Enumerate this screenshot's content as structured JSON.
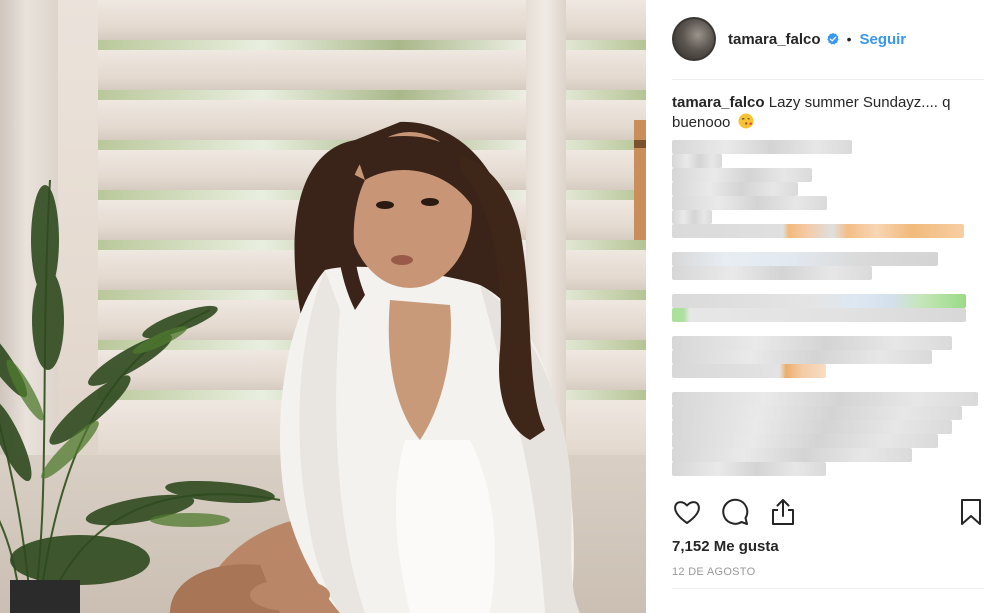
{
  "photo": {
    "alt": ""
  },
  "post": {
    "username": "tamara_falco",
    "follow_label": "Seguir",
    "separator": "•",
    "caption_user": "tamara_falco",
    "caption_text": " Lazy summer Sundayz.... q buenooo",
    "likes": "7,152 Me gusta",
    "date": "12 de agosto"
  },
  "icons": {
    "verified": "verified-badge-icon",
    "emoji": "kissing-face-emoji",
    "like": "heart-icon",
    "comment": "comment-bubble-icon",
    "share": "share-upload-icon",
    "save": "bookmark-icon"
  },
  "colors": {
    "accent": "#3897f0",
    "text": "#262626",
    "muted": "#999999",
    "divider": "#efefef"
  }
}
